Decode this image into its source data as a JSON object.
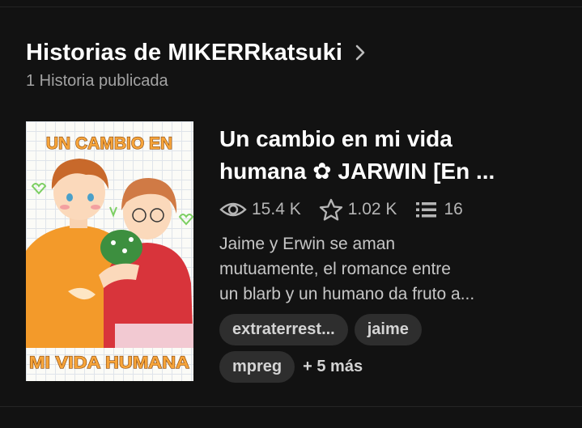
{
  "header": {
    "title": "Historias de MIKERRkatsuki",
    "subtitle": "1 Historia publicada",
    "chevron_icon": "chevron-right-icon"
  },
  "story": {
    "cover": {
      "top_text": "UN CAMBIO EN",
      "bottom_text": "MI VIDA HUMANA",
      "accent_color": "#f7a53a"
    },
    "title_line1": "Un cambio en mi vida",
    "title_line2": "humana ✿ JARWIN [En ...",
    "stats": {
      "reads": "15.4 K",
      "votes": "1.02 K",
      "parts": "16",
      "reads_icon": "eye-icon",
      "votes_icon": "star-icon",
      "parts_icon": "list-icon"
    },
    "description_lines": [
      "Jaime y Erwin se aman",
      "mutuamente, el romance entre",
      "un blarb y un humano da fruto a..."
    ],
    "tags": [
      "extraterrest...",
      "jaime",
      "mpreg"
    ],
    "more_tags": "+ 5 más"
  },
  "colors": {
    "background": "#121212",
    "text_primary": "#ffffff",
    "text_secondary": "#a3a3a3",
    "tag_background": "#2e2e2e"
  }
}
